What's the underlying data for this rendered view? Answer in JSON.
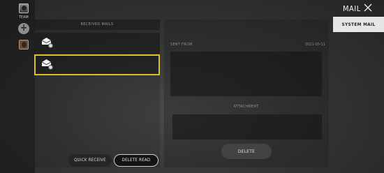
{
  "sidebar": {
    "team_label": "TEAM",
    "add_label": "+"
  },
  "header": {
    "title": "MAIL",
    "system_tab": "SYSTEM MAIL"
  },
  "received": {
    "header": "RECEIVED MAILS",
    "selected_index": 1,
    "quick_receive": "QUICK RECEIVE",
    "delete_read": "DELETE READ"
  },
  "detail": {
    "sent_from_label": "SENT FROM",
    "date": "2021-10-11",
    "attachment_label": "ATTACHMENT",
    "delete_label": "DELETE"
  },
  "colors": {
    "selection_border": "#d9c02a",
    "tab_bg": "#e6e6e6"
  }
}
